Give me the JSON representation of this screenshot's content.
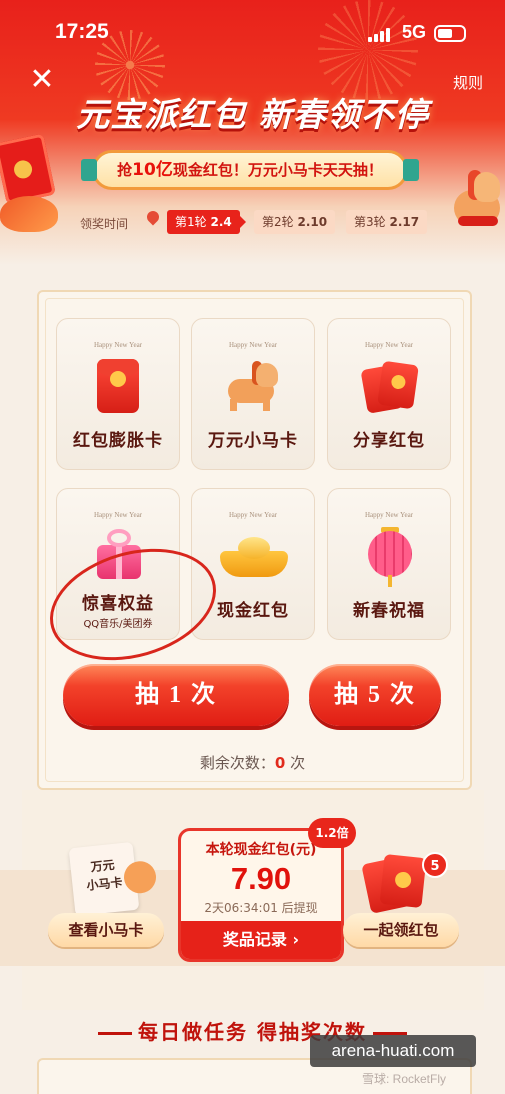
{
  "status_bar": {
    "time": "17:25",
    "network": "5G"
  },
  "header": {
    "rules_label": "规则",
    "title": "元宝派红包 新春领不停",
    "banner_prefix": "抢",
    "banner_highlight": "10亿",
    "banner_suffix": "现金红包！万元小马卡天天抽！",
    "timeline_label": "领奖时间",
    "rounds": [
      {
        "name": "第1轮",
        "date": "2.4",
        "active": true
      },
      {
        "name": "第2轮",
        "date": "2.10",
        "active": false
      },
      {
        "name": "第3轮",
        "date": "2.17",
        "active": false
      }
    ]
  },
  "prizes": {
    "card_caption": "Happy New Year",
    "items": [
      {
        "label": "红包膨胀卡",
        "icon": "red-envelope-icon"
      },
      {
        "label": "万元小马卡",
        "icon": "horse-icon"
      },
      {
        "label": "分享红包",
        "icon": "red-envelopes-icon"
      },
      {
        "label": "惊喜权益",
        "sublabel": "QQ音乐/美团券",
        "icon": "gift-box-icon"
      },
      {
        "label": "现金红包",
        "icon": "gold-ingot-icon"
      },
      {
        "label": "新春祝福",
        "icon": "lantern-icon"
      }
    ]
  },
  "draw": {
    "draw_once_label": "抽 1 次",
    "draw_five_label": "抽 5 次",
    "remaining_prefix": "剩余次数：",
    "remaining_count": "0",
    "remaining_suffix": "次"
  },
  "cash": {
    "multiplier": "1.2倍",
    "title": "本轮现金红包(元)",
    "amount": "7.90",
    "countdown": "2天06:34:01 后提现",
    "records_label": "奖品记录 ›"
  },
  "side": {
    "horse_card_text": "万元\n小马卡",
    "view_horse_label": "查看小马卡",
    "envelope_badge": "5",
    "collect_label": "一起领红包"
  },
  "tasks": {
    "header": "每日做任务 得抽奖次数"
  },
  "watermark": {
    "site": "arena-huati.com",
    "credit": "雪球: RocketFly"
  },
  "colors": {
    "primary_red": "#e8231b",
    "gold": "#ffc94a",
    "background": "#f7efe6"
  }
}
